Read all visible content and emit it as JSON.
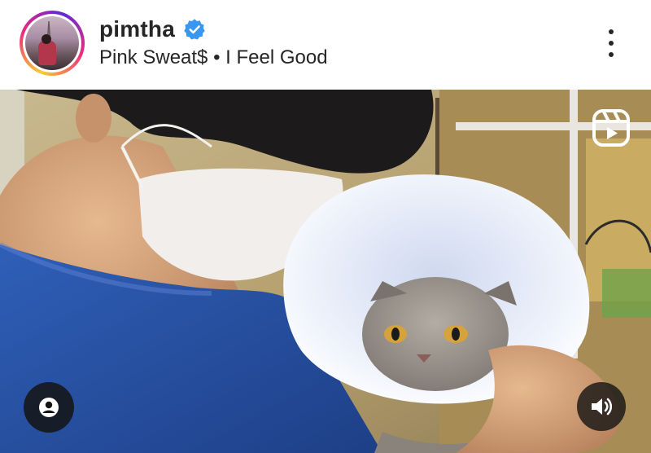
{
  "post": {
    "username": "pimtha",
    "verified": true,
    "audio_track": "Pink Sweat$ • I Feel Good"
  },
  "icons": {
    "verified": "verified-badge-icon",
    "more": "more-options-icon",
    "reels": "reels-icon",
    "user_tag": "user-tag-icon",
    "audio": "volume-on-icon"
  },
  "colors": {
    "verified_blue": "#3897f0",
    "text": "#262626",
    "overlay_button": "#141414"
  }
}
